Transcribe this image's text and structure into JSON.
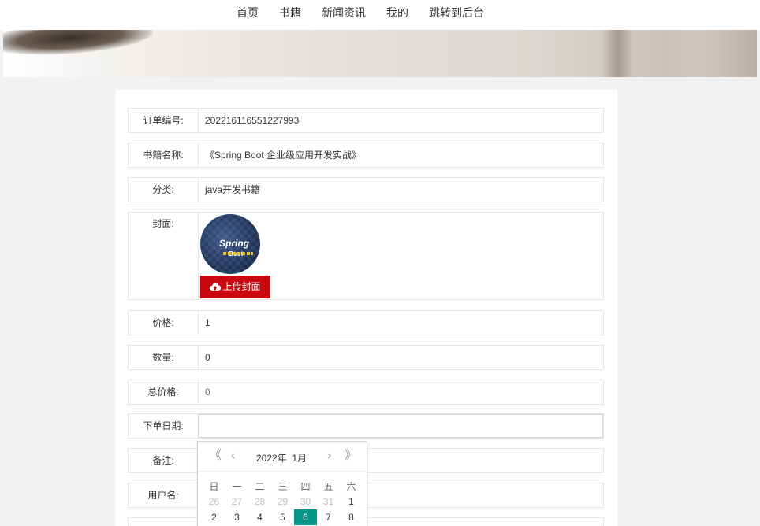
{
  "nav": {
    "items": [
      "首页",
      "书籍",
      "新闻资讯",
      "我的",
      "跳转到后台"
    ]
  },
  "form": {
    "order_no": {
      "label": "订单编号:",
      "value": "202216116551227993"
    },
    "book_name": {
      "label": "书籍名称:",
      "value": "《Spring Boot 企业级应用开发实战》"
    },
    "category": {
      "label": "分类:",
      "value": "java开发书籍"
    },
    "cover": {
      "label": "封面:",
      "upload_label": "上传封面",
      "image_title": "Spring",
      "image_subtitle": "Boot"
    },
    "price": {
      "label": "价格:",
      "value": "1"
    },
    "quantity": {
      "label": "数量:",
      "value": "0"
    },
    "total": {
      "label": "总价格:",
      "value": "0"
    },
    "order_date": {
      "label": "下单日期:",
      "value": ""
    },
    "remark": {
      "label": "备注:",
      "value": ""
    },
    "username": {
      "label": "用户名:",
      "value": ""
    }
  },
  "datepicker": {
    "prev_year": "《",
    "prev_month": "‹",
    "year": "2022年",
    "month": "1月",
    "next_month": "›",
    "next_year": "》",
    "weekdays": [
      "日",
      "一",
      "二",
      "三",
      "四",
      "五",
      "六"
    ],
    "rows": [
      [
        "26",
        "27",
        "28",
        "29",
        "30",
        "31",
        "1"
      ],
      [
        "2",
        "3",
        "4",
        "5",
        "6",
        "7",
        "8"
      ]
    ],
    "selected": "6",
    "accent_color": "#009688"
  },
  "colors": {
    "upload_button": "#c80a10"
  }
}
